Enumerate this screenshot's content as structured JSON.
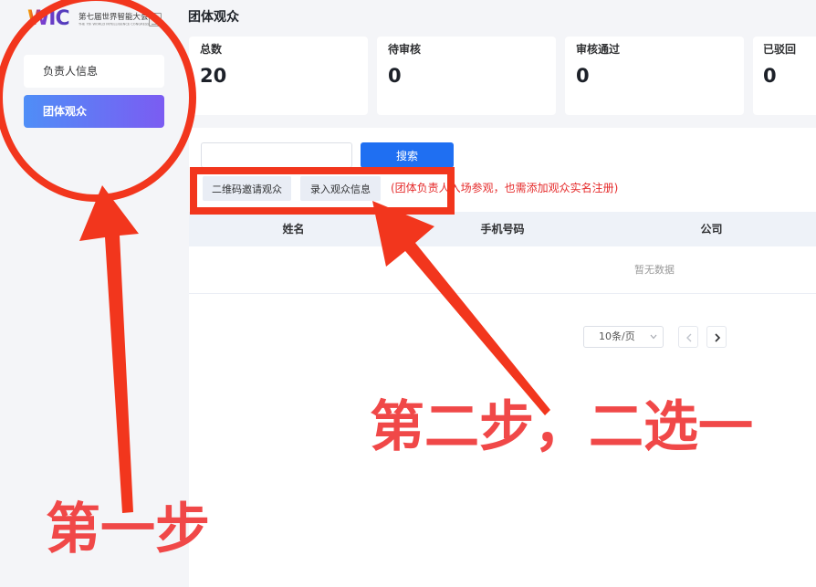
{
  "logo": {
    "mark": "WIC",
    "title": "第七届世界智能大会",
    "subtitle": "THE 7th WORLD INTELLIGENCE CONGRESS",
    "badge_icon": "logo-badge-icon"
  },
  "sidebar": {
    "items": [
      {
        "label": "负责人信息",
        "active": false
      },
      {
        "label": "团体观众",
        "active": true
      }
    ]
  },
  "page": {
    "title": "团体观众"
  },
  "stats": [
    {
      "label": "总数",
      "value": "20"
    },
    {
      "label": "待审核",
      "value": "0"
    },
    {
      "label": "审核通过",
      "value": "0"
    },
    {
      "label": "已驳回",
      "value": "0"
    }
  ],
  "search": {
    "button_label": "搜索"
  },
  "actions": {
    "qr_invite_label": "二维码邀请观众",
    "add_audience_label": "录入观众信息",
    "note": "(团体负责人入场参观，也需添加观众实名注册)"
  },
  "table": {
    "columns": [
      "姓名",
      "手机号码",
      "公司"
    ],
    "empty_text": "暂无数据"
  },
  "pagination": {
    "page_size": "10条/页",
    "select_icon": "chevron-down-icon",
    "prev_icon": "chevron-left-icon",
    "next_icon": "chevron-right-icon"
  },
  "annotations": {
    "step1": "第一步",
    "step2": "第二步，二选一"
  },
  "colors": {
    "accent": "#1f6ff2",
    "annotation": "#f2361d",
    "annotation_text": "#f04848",
    "note": "#e52b2b",
    "active_gradient_start": "#4f8ef7",
    "active_gradient_end": "#7b5cf2"
  }
}
